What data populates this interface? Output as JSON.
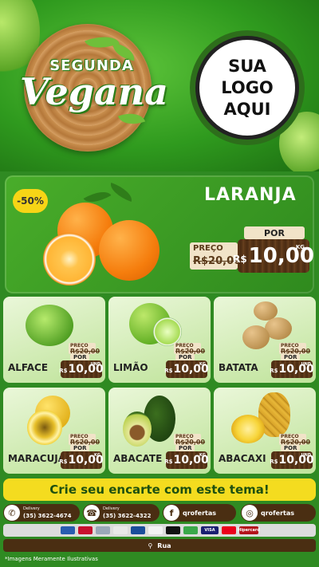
{
  "header": {
    "title_top": "SEGUNDA",
    "title_main": "Vegana",
    "logo_lines": [
      "SUA",
      "LOGO",
      "AQUI"
    ]
  },
  "featured": {
    "discount": "-50%",
    "name": "LARANJA",
    "preco_label": "PREÇO",
    "old_price": "R$20,00",
    "por_label": "POR",
    "currency": "R$",
    "price": "10,00",
    "unit": "KG"
  },
  "products": [
    {
      "name": "ALFACE",
      "preco_label": "PREÇO",
      "old_price": "R$20,00",
      "por_label": "POR",
      "currency": "R$",
      "price": "10,00",
      "unit": "UND"
    },
    {
      "name": "LIMÃO",
      "preco_label": "PREÇO",
      "old_price": "R$20,00",
      "por_label": "POR",
      "currency": "R$",
      "price": "10,00",
      "unit": "KG"
    },
    {
      "name": "BATATA",
      "preco_label": "PREÇO",
      "old_price": "R$20,00",
      "por_label": "POR",
      "currency": "R$",
      "price": "10,00",
      "unit": "UND"
    },
    {
      "name": "MARACUJÁ",
      "preco_label": "PREÇO",
      "old_price": "R$20,00",
      "por_label": "POR",
      "currency": "R$",
      "price": "10,00",
      "unit": "KG"
    },
    {
      "name": "ABACATE",
      "preco_label": "PREÇO",
      "old_price": "R$20,00",
      "por_label": "POR",
      "currency": "R$",
      "price": "10,00",
      "unit": "KG"
    },
    {
      "name": "ABACAXI",
      "preco_label": "PREÇO",
      "old_price": "R$20,00",
      "por_label": "POR",
      "currency": "R$",
      "price": "10,00",
      "unit": "UND"
    }
  ],
  "cta": "Crie seu encarte com este tema!",
  "contacts": [
    {
      "icon": "whatsapp-icon",
      "label": "Delivery",
      "value": "(35) 3622-4674"
    },
    {
      "icon": "phone-icon",
      "label": "Delivery",
      "value": "(35) 3622-4322"
    },
    {
      "icon": "facebook-icon",
      "value": "qrofertas"
    },
    {
      "icon": "instagram-icon",
      "value": "qrofertas"
    }
  ],
  "payments": [
    "VISA",
    "Hipercard"
  ],
  "address": "Rua",
  "footer_note": "*Imagens Meramente Ilustrativas",
  "colors": {
    "background_green": "#2f8a22",
    "banner_yellow": "#f4dc1f",
    "wood_brown": "#4a2e12",
    "price_tag": "#f1e3c8"
  }
}
